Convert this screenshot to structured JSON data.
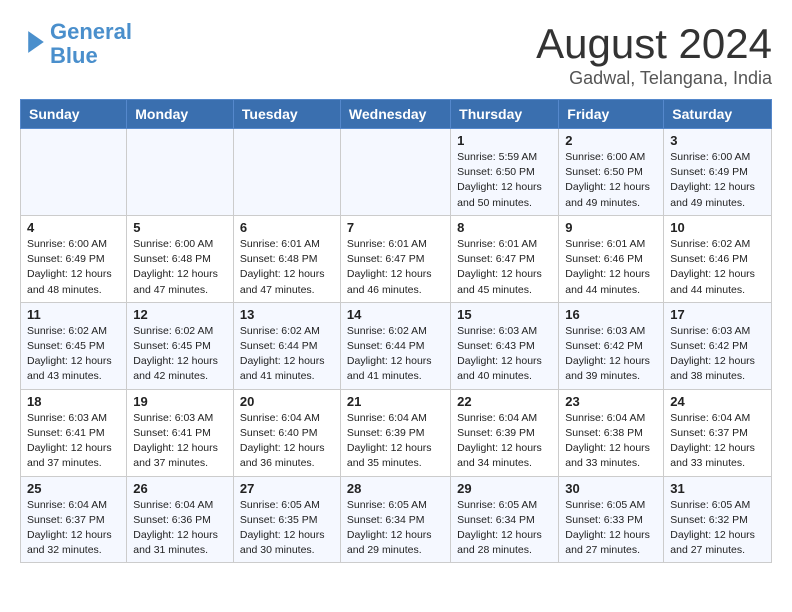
{
  "header": {
    "logo_line1": "General",
    "logo_line2": "Blue",
    "title": "August 2024",
    "subtitle": "Gadwal, Telangana, India"
  },
  "weekdays": [
    "Sunday",
    "Monday",
    "Tuesday",
    "Wednesday",
    "Thursday",
    "Friday",
    "Saturday"
  ],
  "weeks": [
    [
      {
        "day": "",
        "info": ""
      },
      {
        "day": "",
        "info": ""
      },
      {
        "day": "",
        "info": ""
      },
      {
        "day": "",
        "info": ""
      },
      {
        "day": "1",
        "info": "Sunrise: 5:59 AM\nSunset: 6:50 PM\nDaylight: 12 hours\nand 50 minutes."
      },
      {
        "day": "2",
        "info": "Sunrise: 6:00 AM\nSunset: 6:50 PM\nDaylight: 12 hours\nand 49 minutes."
      },
      {
        "day": "3",
        "info": "Sunrise: 6:00 AM\nSunset: 6:49 PM\nDaylight: 12 hours\nand 49 minutes."
      }
    ],
    [
      {
        "day": "4",
        "info": "Sunrise: 6:00 AM\nSunset: 6:49 PM\nDaylight: 12 hours\nand 48 minutes."
      },
      {
        "day": "5",
        "info": "Sunrise: 6:00 AM\nSunset: 6:48 PM\nDaylight: 12 hours\nand 47 minutes."
      },
      {
        "day": "6",
        "info": "Sunrise: 6:01 AM\nSunset: 6:48 PM\nDaylight: 12 hours\nand 47 minutes."
      },
      {
        "day": "7",
        "info": "Sunrise: 6:01 AM\nSunset: 6:47 PM\nDaylight: 12 hours\nand 46 minutes."
      },
      {
        "day": "8",
        "info": "Sunrise: 6:01 AM\nSunset: 6:47 PM\nDaylight: 12 hours\nand 45 minutes."
      },
      {
        "day": "9",
        "info": "Sunrise: 6:01 AM\nSunset: 6:46 PM\nDaylight: 12 hours\nand 44 minutes."
      },
      {
        "day": "10",
        "info": "Sunrise: 6:02 AM\nSunset: 6:46 PM\nDaylight: 12 hours\nand 44 minutes."
      }
    ],
    [
      {
        "day": "11",
        "info": "Sunrise: 6:02 AM\nSunset: 6:45 PM\nDaylight: 12 hours\nand 43 minutes."
      },
      {
        "day": "12",
        "info": "Sunrise: 6:02 AM\nSunset: 6:45 PM\nDaylight: 12 hours\nand 42 minutes."
      },
      {
        "day": "13",
        "info": "Sunrise: 6:02 AM\nSunset: 6:44 PM\nDaylight: 12 hours\nand 41 minutes."
      },
      {
        "day": "14",
        "info": "Sunrise: 6:02 AM\nSunset: 6:44 PM\nDaylight: 12 hours\nand 41 minutes."
      },
      {
        "day": "15",
        "info": "Sunrise: 6:03 AM\nSunset: 6:43 PM\nDaylight: 12 hours\nand 40 minutes."
      },
      {
        "day": "16",
        "info": "Sunrise: 6:03 AM\nSunset: 6:42 PM\nDaylight: 12 hours\nand 39 minutes."
      },
      {
        "day": "17",
        "info": "Sunrise: 6:03 AM\nSunset: 6:42 PM\nDaylight: 12 hours\nand 38 minutes."
      }
    ],
    [
      {
        "day": "18",
        "info": "Sunrise: 6:03 AM\nSunset: 6:41 PM\nDaylight: 12 hours\nand 37 minutes."
      },
      {
        "day": "19",
        "info": "Sunrise: 6:03 AM\nSunset: 6:41 PM\nDaylight: 12 hours\nand 37 minutes."
      },
      {
        "day": "20",
        "info": "Sunrise: 6:04 AM\nSunset: 6:40 PM\nDaylight: 12 hours\nand 36 minutes."
      },
      {
        "day": "21",
        "info": "Sunrise: 6:04 AM\nSunset: 6:39 PM\nDaylight: 12 hours\nand 35 minutes."
      },
      {
        "day": "22",
        "info": "Sunrise: 6:04 AM\nSunset: 6:39 PM\nDaylight: 12 hours\nand 34 minutes."
      },
      {
        "day": "23",
        "info": "Sunrise: 6:04 AM\nSunset: 6:38 PM\nDaylight: 12 hours\nand 33 minutes."
      },
      {
        "day": "24",
        "info": "Sunrise: 6:04 AM\nSunset: 6:37 PM\nDaylight: 12 hours\nand 33 minutes."
      }
    ],
    [
      {
        "day": "25",
        "info": "Sunrise: 6:04 AM\nSunset: 6:37 PM\nDaylight: 12 hours\nand 32 minutes."
      },
      {
        "day": "26",
        "info": "Sunrise: 6:04 AM\nSunset: 6:36 PM\nDaylight: 12 hours\nand 31 minutes."
      },
      {
        "day": "27",
        "info": "Sunrise: 6:05 AM\nSunset: 6:35 PM\nDaylight: 12 hours\nand 30 minutes."
      },
      {
        "day": "28",
        "info": "Sunrise: 6:05 AM\nSunset: 6:34 PM\nDaylight: 12 hours\nand 29 minutes."
      },
      {
        "day": "29",
        "info": "Sunrise: 6:05 AM\nSunset: 6:34 PM\nDaylight: 12 hours\nand 28 minutes."
      },
      {
        "day": "30",
        "info": "Sunrise: 6:05 AM\nSunset: 6:33 PM\nDaylight: 12 hours\nand 27 minutes."
      },
      {
        "day": "31",
        "info": "Sunrise: 6:05 AM\nSunset: 6:32 PM\nDaylight: 12 hours\nand 27 minutes."
      }
    ]
  ]
}
